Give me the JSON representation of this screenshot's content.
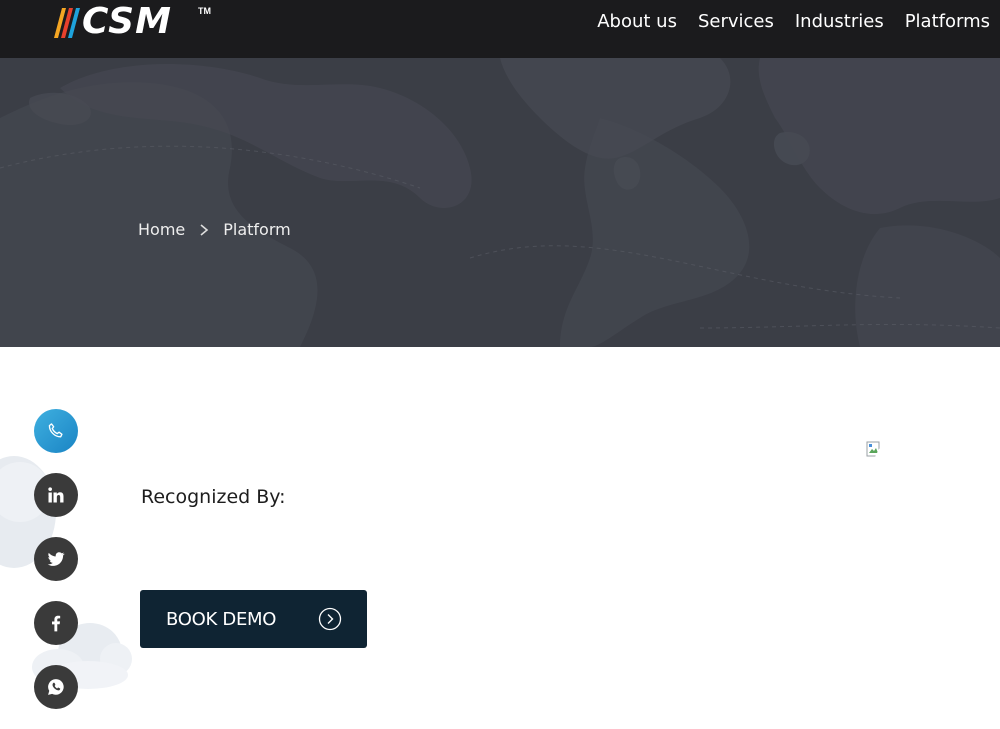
{
  "header": {
    "logo": {
      "text": "CSM",
      "trademark": "TM",
      "stripe_colors": [
        "#f5a623",
        "#e8412c",
        "#1ea3dc"
      ]
    },
    "nav": [
      {
        "label": "About us"
      },
      {
        "label": "Services"
      },
      {
        "label": "Industries"
      },
      {
        "label": "Platforms"
      }
    ]
  },
  "hero": {
    "breadcrumb": {
      "home": "Home",
      "current": "Platform"
    }
  },
  "main": {
    "recognized_label": "Recognized By:",
    "book_demo_label": "BOOK DEMO",
    "image": {
      "icon": "broken-image-icon"
    }
  },
  "social": [
    {
      "icon": "phone-icon"
    },
    {
      "icon": "linkedin-icon"
    },
    {
      "icon": "twitter-icon"
    },
    {
      "icon": "facebook-icon"
    },
    {
      "icon": "whatsapp-icon"
    }
  ],
  "colors": {
    "header_bg": "#1b1b1d",
    "hero_bg": "#3b3e46",
    "button_bg": "#0f2433",
    "phone_accent": "#1a84c4",
    "social_bg": "#3a3a3a"
  }
}
